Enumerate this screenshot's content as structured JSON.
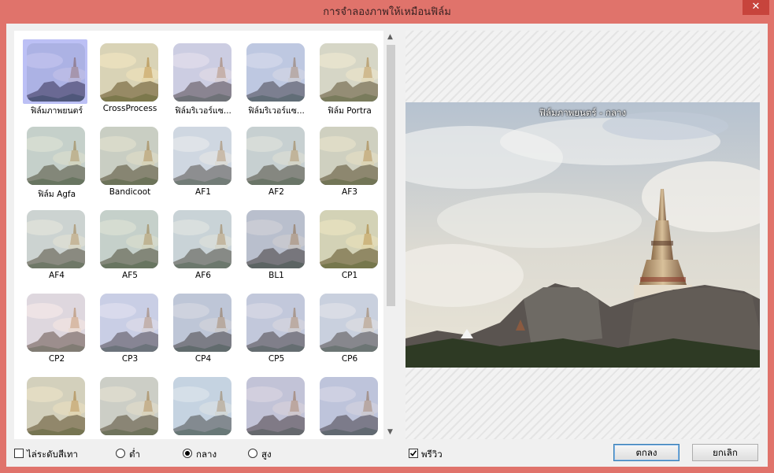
{
  "window": {
    "title": "การจำลองภาพให้เหมือนฟิล์ม",
    "close_glyph": "✕"
  },
  "presets": [
    {
      "label": "ฟิล์มภาพยนตร์",
      "tint": "#7d80ee",
      "selected": true
    },
    {
      "label": "CrossProcess",
      "tint": "#e8d080"
    },
    {
      "label": "ฟิล์มริเวอร์แซ...",
      "tint": "#c8c2ea"
    },
    {
      "label": "ฟิล์มริเวอร์แซ...",
      "tint": "#a8b4e8"
    },
    {
      "label": "ฟิล์ม Portra",
      "tint": "#e0d6a8"
    },
    {
      "label": "ฟิล์ม Agfa",
      "tint": "#b8c8b0"
    },
    {
      "label": "Bandicoot",
      "tint": "#c0c4a0"
    },
    {
      "label": "AF1",
      "tint": "#d0d8e8"
    },
    {
      "label": "AF2",
      "tint": "#bcc8c0"
    },
    {
      "label": "AF3",
      "tint": "#d0c898"
    },
    {
      "label": "AF4",
      "tint": "#c8d0c0"
    },
    {
      "label": "AF5",
      "tint": "#b8c8b0"
    },
    {
      "label": "AF6",
      "tint": "#c0d0d0"
    },
    {
      "label": "BL1",
      "tint": "#9aa0b8"
    },
    {
      "label": "CP1",
      "tint": "#d8cc80"
    },
    {
      "label": "CP2",
      "tint": "#f2d8e0"
    },
    {
      "label": "CP3",
      "tint": "#c0c4f0"
    },
    {
      "label": "CP4",
      "tint": "#a8b0d0"
    },
    {
      "label": "CP5",
      "tint": "#b0b4d8"
    },
    {
      "label": "CP6",
      "tint": "#c0c8e0"
    },
    {
      "label": "",
      "tint": "#d8c890"
    },
    {
      "label": "",
      "tint": "#c8c4a8"
    },
    {
      "label": "",
      "tint": "#b8d0e8"
    },
    {
      "label": "",
      "tint": "#b0aad0"
    },
    {
      "label": "",
      "tint": "#a8acd8"
    }
  ],
  "preview": {
    "caption": "ฟิล์มภาพยนตร์ - กลาง"
  },
  "options": {
    "grayscale_label": "ไล่ระดับสีเทา",
    "grayscale_checked": false,
    "low_label": "ต่ำ",
    "medium_label": "กลาง",
    "high_label": "สูง",
    "strength_selected": "กลาง",
    "preview_label": "พรีวิว",
    "preview_checked": true
  },
  "buttons": {
    "ok": "ตกลง",
    "cancel": "ยกเลิก"
  }
}
